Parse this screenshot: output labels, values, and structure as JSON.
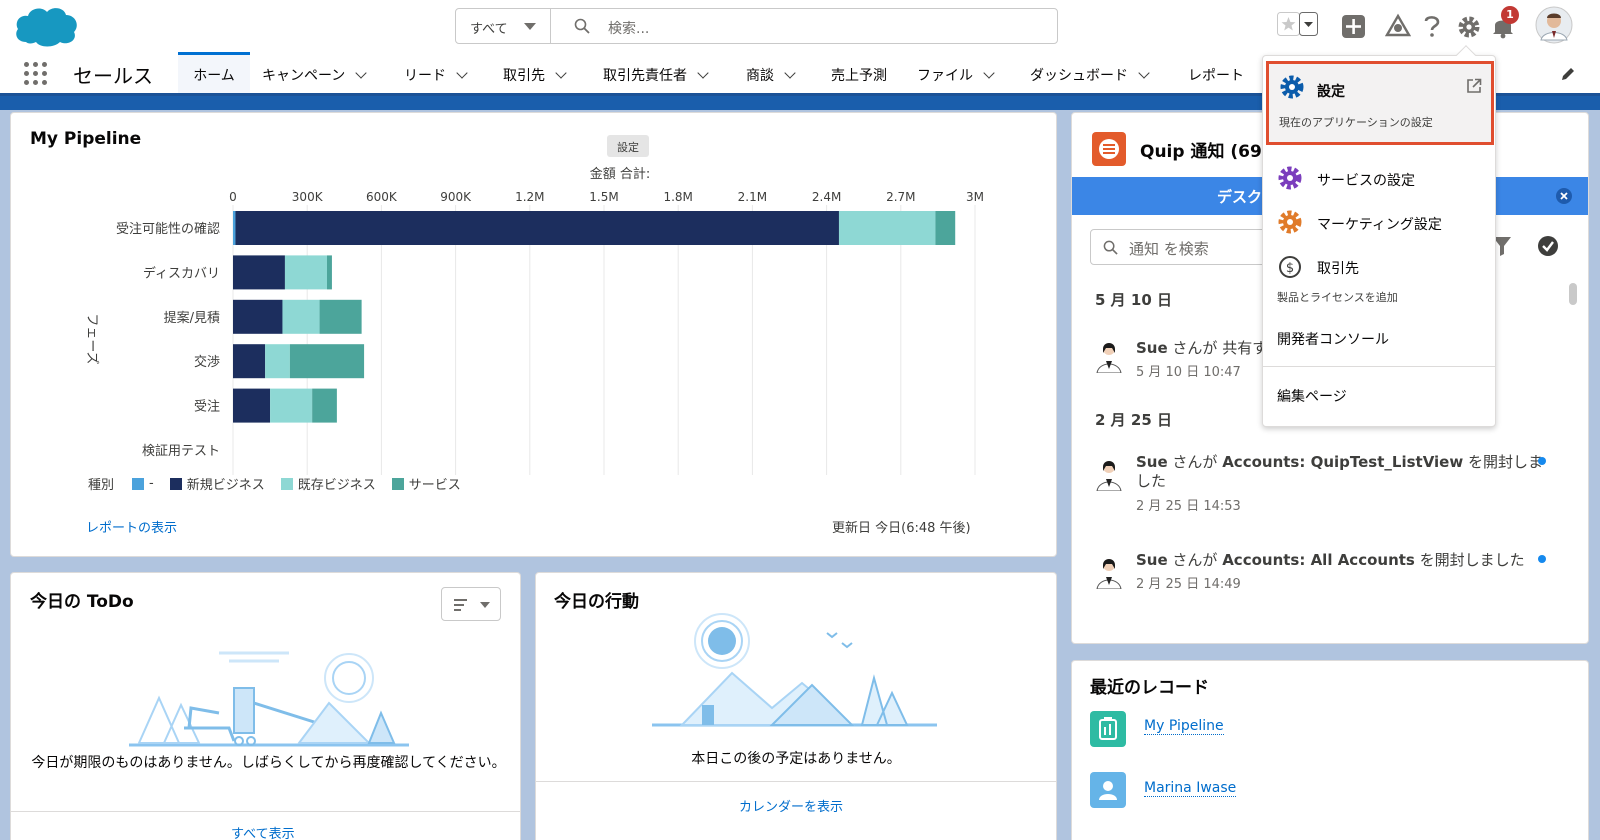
{
  "search": {
    "scope": "すべて",
    "placeholder": "検索..."
  },
  "header": {
    "notification_count": "1"
  },
  "nav": {
    "app_name": "セールス",
    "tabs": [
      "ホーム",
      "キャンペーン",
      "リード",
      "取引先",
      "取引先責任者",
      "商談",
      "売上予測",
      "ファイル",
      "ダッシュボード",
      "レポート"
    ]
  },
  "pipeline": {
    "title": "My Pipeline",
    "tooltip": "設定",
    "view_report": "レポートの表示",
    "updated": "更新日 今日(6:48 午後)"
  },
  "chart_data": {
    "type": "bar",
    "orientation": "horizontal",
    "stacked": true,
    "title": "金額 合計:",
    "ylabel": "フェーズ",
    "categories": [
      "受注可能性の確認",
      "ディスカバリ",
      "提案/見積",
      "交渉",
      "受注",
      "検証用テスト"
    ],
    "x_ticks": [
      "0",
      "300K",
      "600K",
      "900K",
      "1.2M",
      "1.5M",
      "1.8M",
      "2.1M",
      "2.4M",
      "2.7M",
      "3M"
    ],
    "xlim": [
      0,
      3000000
    ],
    "legend_title": "種別",
    "series": [
      {
        "name": "-",
        "color": "#4ba2dc",
        "values": [
          10000,
          0,
          0,
          0,
          0,
          0
        ]
      },
      {
        "name": "新規ビジネス",
        "color": "#1c2e5e",
        "values": [
          2440000,
          210000,
          200000,
          130000,
          150000,
          0
        ]
      },
      {
        "name": "既存ビジネス",
        "color": "#8ed8d4",
        "values": [
          390000,
          170000,
          150000,
          100000,
          170000,
          0
        ]
      },
      {
        "name": "サービス",
        "color": "#4ca59b",
        "values": [
          80000,
          20000,
          170000,
          300000,
          100000,
          0
        ]
      }
    ],
    "grid": true
  },
  "todo": {
    "title": "今日の ToDo",
    "empty": "今日が期限のものはありません。しばらくしてから再度確認してください。",
    "view_all": "すべて表示"
  },
  "events": {
    "title": "今日の行動",
    "empty": "本日この後の予定はありません。",
    "view_calendar": "カレンダーを表示"
  },
  "quip": {
    "title": "Quip 通知 (69)",
    "banner": "デスク",
    "search_placeholder": "通知 を検索",
    "groups": [
      {
        "date": "5 月 10 日",
        "items": [
          {
            "actor": "Sue",
            "text": " さんが 共有す",
            "time": "5 月 10 日 10:47"
          }
        ]
      },
      {
        "date": "2 月 25 日",
        "items": [
          {
            "actor": "Sue",
            "text": " さんが ",
            "doc": "Accounts: QuipTest_ListView",
            "rest": " を開封しま",
            "rest2": "した",
            "time": "2 月 25 日 14:53"
          },
          {
            "actor": "Sue",
            "text": " さんが ",
            "doc": "Accounts: All Accounts",
            "rest": " を開封しました",
            "time": "2 月 25 日 14:49"
          }
        ]
      }
    ]
  },
  "recent": {
    "title": "最近のレコード",
    "items": [
      "My Pipeline",
      "Marina Iwase"
    ]
  },
  "setup_menu": {
    "setup": "設定",
    "setup_sub": "現在のアプリケーションの設定",
    "service": "サービスの設定",
    "marketing": "マーケティング設定",
    "accounts": "取引先",
    "accounts_sub": "製品とライセンスを追加",
    "dev_console": "開発者コンソール",
    "edit_page": "編集ページ"
  },
  "colors": {
    "brand": "#0070d2",
    "header_strip": "#1a5eac",
    "highlight": "#e04e2f",
    "background": "#b0c4df"
  }
}
